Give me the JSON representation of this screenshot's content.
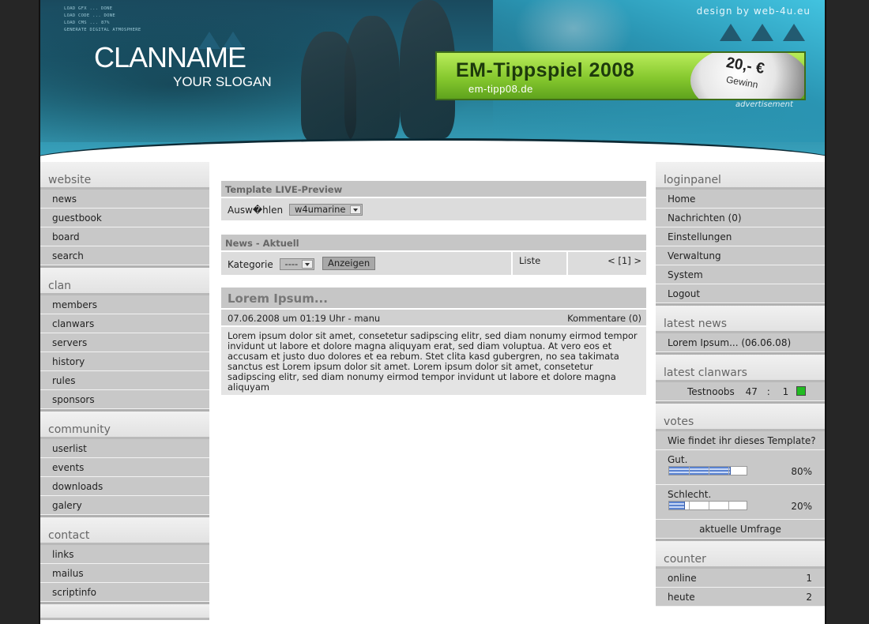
{
  "header": {
    "load_lines": [
      "LOAD GFX ... DONE",
      "LOAD CODE ... DONE",
      "LOAD CMS ... 87%",
      "GENERATE DIGITAL ATMOSPHERE"
    ],
    "clan_name": "CLANNAME",
    "slogan": "YOUR SLOGAN",
    "designer": "design by web-4u.eu",
    "banner": {
      "title": "EM-Tippspiel 2008",
      "url": "em-tipp08.de",
      "price": "20,- €",
      "price_sub": "Gewinn",
      "label": "advertisement"
    }
  },
  "left": {
    "website": {
      "title": "website",
      "items": [
        "news",
        "guestbook",
        "board",
        "search"
      ]
    },
    "clan": {
      "title": "clan",
      "items": [
        "members",
        "clanwars",
        "servers",
        "history",
        "rules",
        "sponsors"
      ]
    },
    "community": {
      "title": "community",
      "items": [
        "userlist",
        "events",
        "downloads",
        "galery"
      ]
    },
    "contact": {
      "title": "contact",
      "items": [
        "links",
        "mailus",
        "scriptinfo"
      ]
    }
  },
  "content": {
    "preview": {
      "head": "Template LIVE-Preview",
      "label": "Ausw�hlen",
      "selected": "w4umarine"
    },
    "news_nav": {
      "head": "News - Aktuell",
      "category_label": "Kategorie",
      "category_value": "----",
      "show_button": "Anzeigen",
      "list_label": "Liste",
      "pager": "< [1] >"
    },
    "article": {
      "title": "Lorem Ipsum...",
      "meta": "07.06.2008 um 01:19 Uhr - manu",
      "comments": "Kommentare (0)",
      "body": "Lorem ipsum dolor sit amet, consetetur sadipscing elitr, sed diam nonumy eirmod tempor invidunt ut labore et dolore magna aliquyam erat, sed diam voluptua. At vero eos et accusam et justo duo dolores et ea rebum. Stet clita kasd gubergren, no sea takimata sanctus est Lorem ipsum dolor sit amet. Lorem ipsum dolor sit amet, consetetur sadipscing elitr, sed diam nonumy eirmod tempor invidunt ut labore et dolore magna aliquyam"
    }
  },
  "right": {
    "login": {
      "title": "loginpanel",
      "items": [
        "Home",
        "Nachrichten (0)",
        "Einstellungen",
        "Verwaltung",
        "System",
        "Logout"
      ]
    },
    "latest_news": {
      "title": "latest news",
      "item": "Lorem Ipsum... (06.06.08)"
    },
    "latest_clanwars": {
      "title": "latest clanwars",
      "opponent": "Testnoobs",
      "score_own": "47",
      "separator": ":",
      "score_opp": "1",
      "result_color": "#22bb22"
    },
    "votes": {
      "title": "votes",
      "question": "Wie findet ihr dieses Template?",
      "options": [
        {
          "label": "Gut.",
          "percent_text": "80%",
          "percent": 80
        },
        {
          "label": "Schlecht.",
          "percent_text": "20%",
          "percent": 20
        }
      ],
      "link": "aktuelle Umfrage"
    },
    "counter": {
      "title": "counter",
      "rows": [
        {
          "label": "online",
          "value": "1"
        },
        {
          "label": "heute",
          "value": "2"
        }
      ]
    }
  }
}
